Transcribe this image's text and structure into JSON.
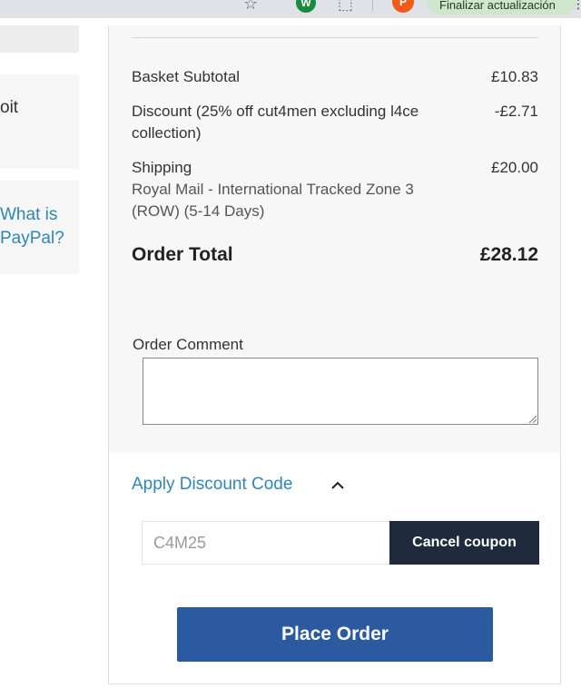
{
  "browser": {
    "update_label": "Finalizar actualización",
    "profile_initial": "P",
    "extension_initial": "W"
  },
  "left": {
    "partial_text_1": "oit",
    "partial_text_2": "What is PayPal?"
  },
  "summary": {
    "subtotal_label": "Basket Subtotal",
    "subtotal_value": "£10.83",
    "discount_label": "Discount (25% off cut4men excluding l4ce collection)",
    "discount_value": "-£2.71",
    "shipping_label": "Shipping",
    "shipping_detail": "Royal Mail - International Tracked Zone 3 (ROW) (5-14 Days)",
    "shipping_value": "£20.00",
    "total_label": "Order Total",
    "total_value": "£28.12"
  },
  "comment": {
    "label": "Order Comment",
    "value": ""
  },
  "discount_code": {
    "toggle_label": "Apply Discount Code",
    "input_value": "C4M25",
    "cancel_label": "Cancel coupon"
  },
  "actions": {
    "place_order_label": "Place Order"
  },
  "colors": {
    "link_blue": "#2f86b4",
    "place_order_bg": "#2b5aa0",
    "cancel_coupon_bg": "#1f2a3c",
    "panel_grey": "#f7f7f7"
  }
}
